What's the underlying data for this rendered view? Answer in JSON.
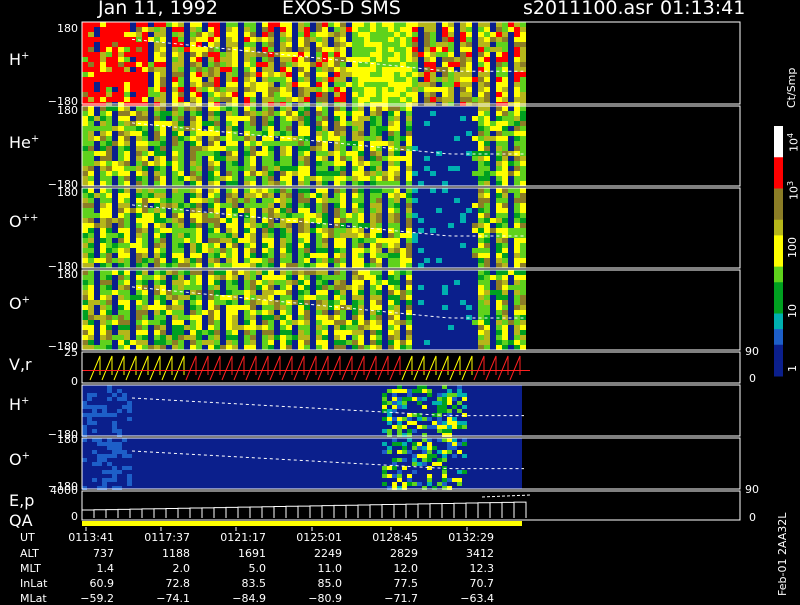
{
  "header": {
    "date": "Jan 11, 1992",
    "instrument": "EXOS-D SMS",
    "file": "s2011100.asr",
    "time": "01:13:41"
  },
  "panels": [
    {
      "label": "H",
      "sup": "+",
      "top": "180",
      "bottom": "−180"
    },
    {
      "label": "He",
      "sup": "+",
      "top": "180",
      "bottom": "−180"
    },
    {
      "label": "O",
      "sup": "++",
      "top": "180",
      "bottom": "−180"
    },
    {
      "label": "O",
      "sup": "+",
      "top": "180",
      "bottom": "−180"
    },
    {
      "label": "V,r",
      "sup": "",
      "top": "25",
      "bottom": "0",
      "right_top": "90",
      "right_bottom": "0"
    },
    {
      "label": "H",
      "sup": "+",
      "top": "",
      "bottom": "−180"
    },
    {
      "label": "O",
      "sup": "+",
      "top": "180",
      "bottom": "−180"
    },
    {
      "label": "E,p",
      "sup": "",
      "top": "4000",
      "bottom": "0",
      "right_top": "90",
      "right_bottom": "0"
    }
  ],
  "qa_label": "QA",
  "colorbar": {
    "unit": "Ct/Smp",
    "ticks": [
      {
        "base": "10",
        "exp": "4"
      },
      {
        "base": "10",
        "exp": "3"
      },
      {
        "base": "100",
        "exp": ""
      },
      {
        "base": "10",
        "exp": ""
      },
      {
        "base": "1",
        "exp": ""
      }
    ],
    "colors": [
      "#ffffff",
      "#ff0000",
      "#8b7d26",
      "#b5b61a",
      "#ffff00",
      "#5fd21c",
      "#00a020",
      "#00b0b0",
      "#1d5fc8",
      "#0b1f8c"
    ]
  },
  "footer_id": "Feb-01 2AA32L",
  "table": {
    "row_labels": [
      "UT",
      "ALT",
      "MLT",
      "InLat",
      "MLat"
    ],
    "columns": [
      [
        "0113:41",
        "737",
        "1.4",
        "60.9",
        "−59.2"
      ],
      [
        "0117:37",
        "1188",
        "2.0",
        "72.8",
        "−74.1"
      ],
      [
        "0121:17",
        "1691",
        "5.0",
        "83.5",
        "−84.9"
      ],
      [
        "0125:01",
        "2249",
        "11.0",
        "85.0",
        "−80.9"
      ],
      [
        "0128:45",
        "2829",
        "12.0",
        "77.5",
        "−71.7"
      ],
      [
        "0132:29",
        "3412",
        "12.3",
        "70.7",
        "−63.4"
      ]
    ]
  },
  "chart_data": {
    "type": "heatmap",
    "title": "Jan 11, 1992   EXOS-D SMS",
    "x_tick_labels": [
      "0113:41",
      "0117:37",
      "0121:17",
      "0125:01",
      "0128:45",
      "0132:29"
    ],
    "series": [
      {
        "name": "H+"
      },
      {
        "name": "He+"
      },
      {
        "name": "O++"
      },
      {
        "name": "O+"
      },
      {
        "name": "V,r"
      },
      {
        "name": "H+"
      },
      {
        "name": "O+"
      },
      {
        "name": "E,p"
      }
    ],
    "color_scale": {
      "unit": "Ct/Smp",
      "log": true,
      "range": [
        1,
        10000
      ]
    }
  }
}
